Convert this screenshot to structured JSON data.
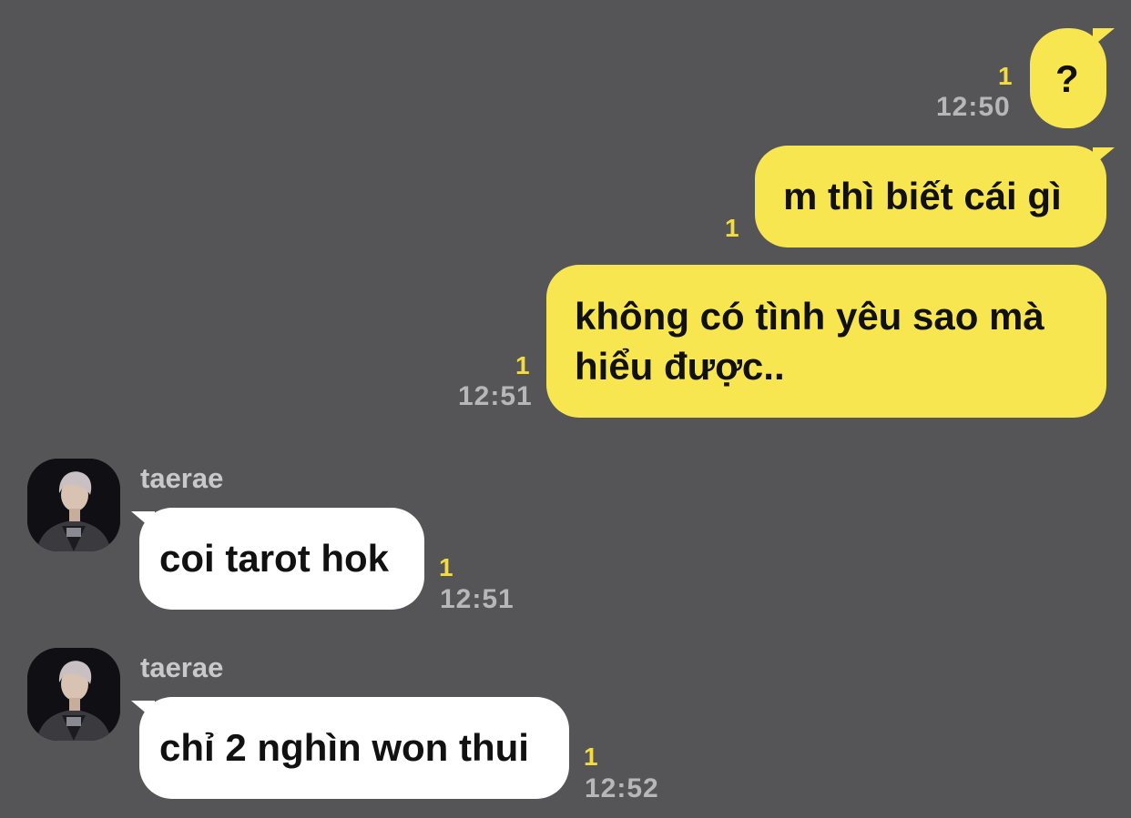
{
  "messages": [
    {
      "sender": "me",
      "text": "?",
      "unread": "1",
      "time": "12:50"
    },
    {
      "sender": "me",
      "text": "m thì biết cái gì",
      "unread": "1",
      "time": ""
    },
    {
      "sender": "me",
      "line1": "không có tình yêu sao mà",
      "line2": "hiểu được..",
      "unread": "1",
      "time": "12:51"
    },
    {
      "sender": "taerae",
      "text": "coi tarot hok",
      "unread": "1",
      "time": "12:51"
    },
    {
      "sender": "taerae",
      "text": "chỉ 2 nghìn won thui",
      "unread": "1",
      "time": "12:52"
    }
  ],
  "colors": {
    "background": "#555456",
    "sent_bubble": "#f8e650",
    "received_bubble": "#ffffff",
    "unread": "#f3dc3e",
    "time": "#b7b6b8"
  },
  "icons": {
    "avatar": "profile-photo-avatar"
  }
}
